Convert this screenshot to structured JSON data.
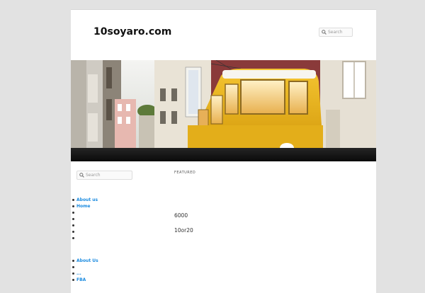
{
  "site": {
    "title": "10soyaro.com"
  },
  "header_search": {
    "placeholder": "Search",
    "icon": "search-icon"
  },
  "banner": {
    "description_icon": "header-image-tram"
  },
  "sidebar": {
    "search": {
      "placeholder": "Search"
    },
    "list_a": [
      "About us",
      "Home",
      "",
      "",
      "",
      "",
      ""
    ],
    "list_b": [
      "About Us",
      "",
      "...",
      "FBA"
    ]
  },
  "main": {
    "featured_label": "FEATURED",
    "items": [
      "6000",
      "10or20"
    ]
  },
  "colors": {
    "link": "#1b8be0",
    "access_bar": "#121212",
    "background": "#e2e2e2"
  }
}
